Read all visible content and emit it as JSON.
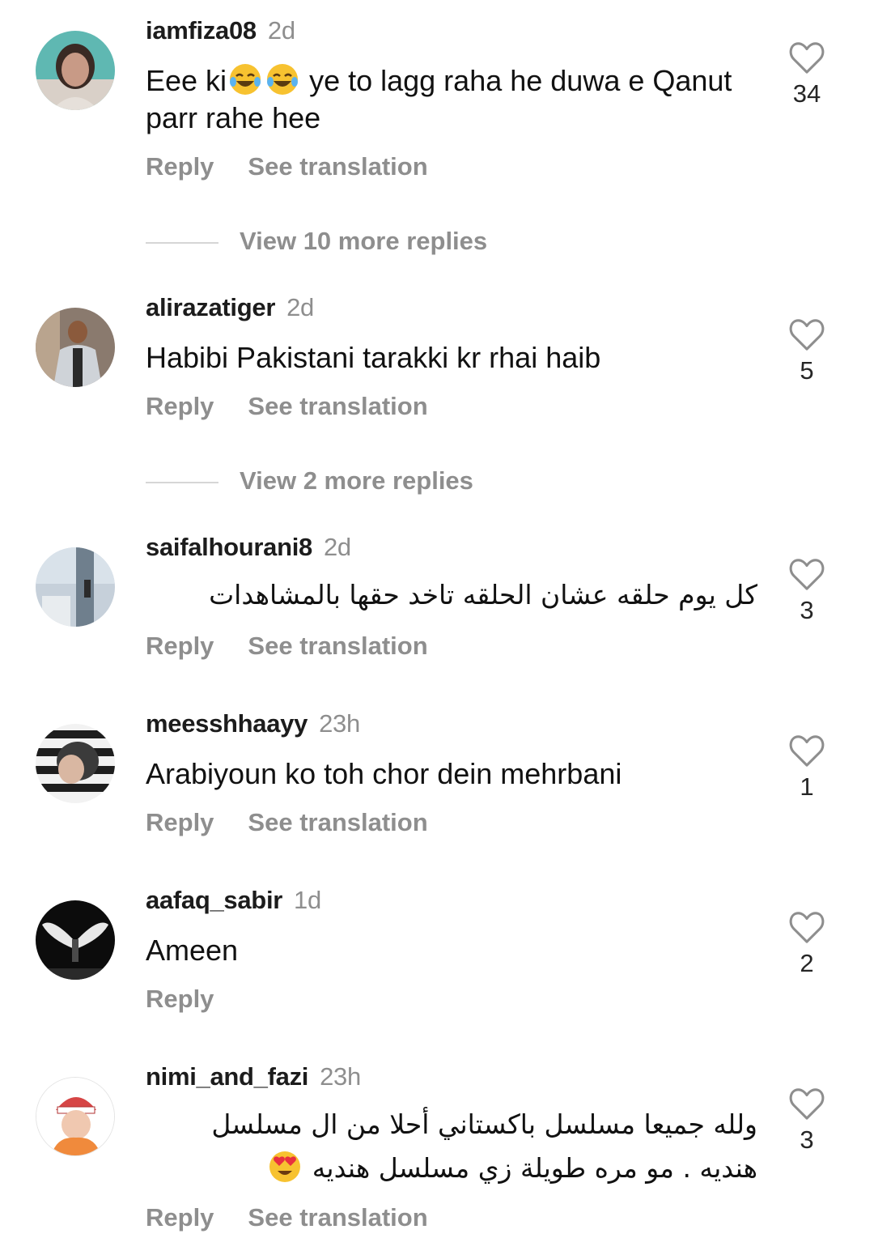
{
  "comments": [
    {
      "username": "iamfiza08",
      "time": "2d",
      "text_before": "Eee ki",
      "emoji": "laughing-tears-emoji",
      "text_after": " ye to lagg raha he duwa e Qanut parr rahe hee",
      "likes": "34",
      "reply": "Reply",
      "translate": "See translation",
      "more_replies": "View 10 more replies"
    },
    {
      "username": "alirazatiger",
      "time": "2d",
      "text": "Habibi Pakistani tarakki kr rhai haib",
      "likes": "5",
      "reply": "Reply",
      "translate": "See translation",
      "more_replies": "View 2 more replies"
    },
    {
      "username": "saifalhourani8",
      "time": "2d",
      "text": "كل يوم حلقه عشان  الحلقه  تاخد حقها بالمشاهدات",
      "likes": "3",
      "reply": "Reply",
      "translate": "See translation"
    },
    {
      "username": "meesshhaayy",
      "time": "23h",
      "text": "Arabiyoun ko toh chor dein mehrbani",
      "likes": "1",
      "reply": "Reply",
      "translate": "See translation"
    },
    {
      "username": "aafaq_sabir",
      "time": "1d",
      "text": "Ameen",
      "likes": "2",
      "reply": "Reply"
    },
    {
      "username": "nimi_and_fazi",
      "time": "23h",
      "text": "ولله جميعا مسلسل باكستاني أحلا من ال مسلسل هنديه . مو مره طويلة زي مسلسل هنديه",
      "emoji": "heart-eyes-emoji",
      "likes": "3",
      "reply": "Reply",
      "translate": "See translation"
    }
  ],
  "colors": {
    "username": "#1c1c1c",
    "meta": "#8e8e8e",
    "body_text": "#111111",
    "divider": "#d6d6d6"
  }
}
